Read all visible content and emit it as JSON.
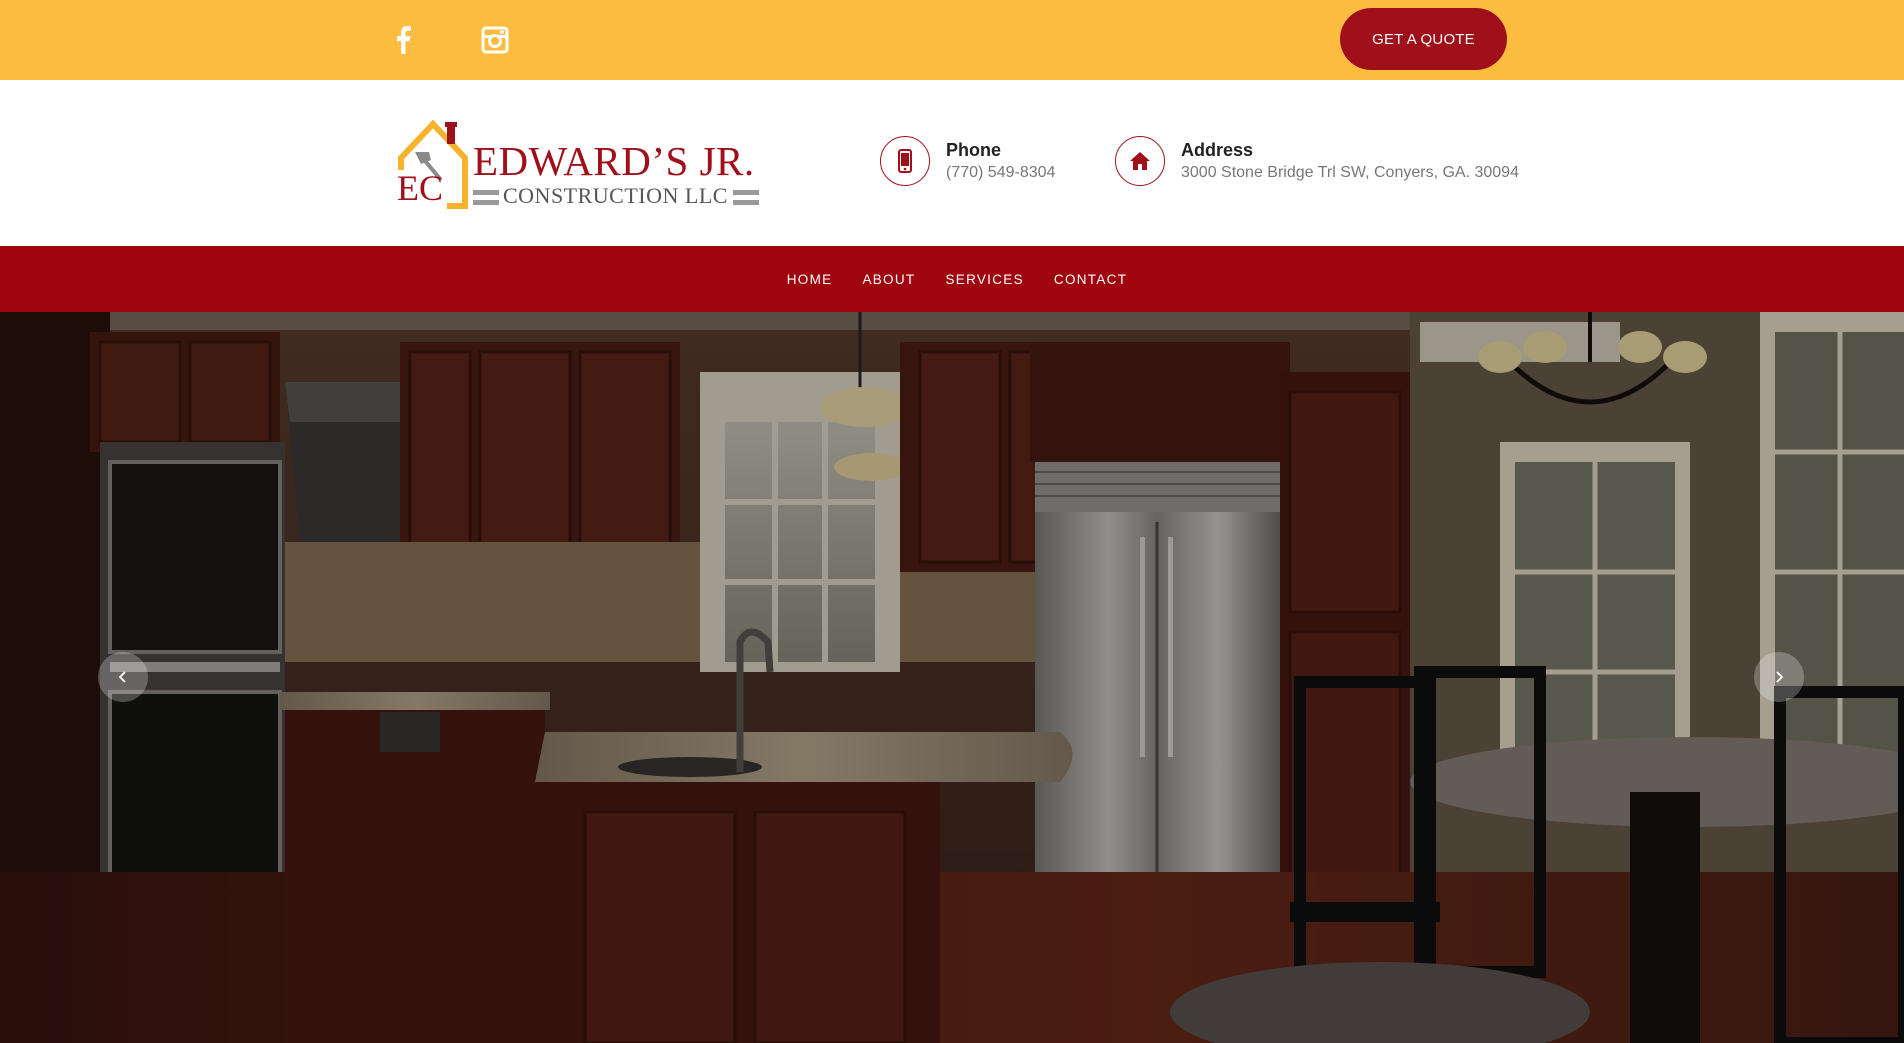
{
  "topbar": {
    "social": [
      {
        "name": "facebook",
        "icon": "facebook-icon"
      },
      {
        "name": "instagram",
        "icon": "instagram-icon"
      }
    ],
    "quote_button": "GET A QUOTE"
  },
  "header": {
    "logo": {
      "top_text": "EDWARD’S JR.",
      "bottom_text": "CONSTRUCTION LLC",
      "initials": "EC"
    },
    "phone": {
      "title": "Phone",
      "value": "(770) 549-8304",
      "icon": "mobile-phone-icon"
    },
    "address": {
      "title": "Address",
      "value": "3000 Stone Bridge Trl SW, Conyers, GA. 30094",
      "icon": "home-icon"
    }
  },
  "nav": {
    "items": [
      "HOME",
      "ABOUT",
      "SERVICES",
      "CONTACT"
    ]
  },
  "hero": {
    "image": "kitchen-interior-photo",
    "prev_icon": "chevron-left-icon",
    "next_icon": "chevron-right-icon"
  },
  "colors": {
    "topbar": "#fbbc40",
    "brand_red": "#a0050f",
    "button_red": "#a0101a"
  }
}
